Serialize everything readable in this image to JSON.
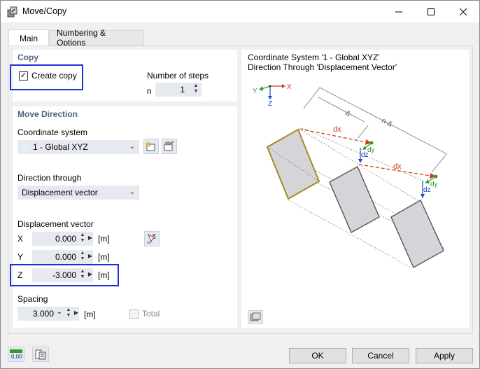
{
  "window": {
    "title": "Move/Copy",
    "icon": "move-copy-app-icon",
    "controls": [
      "minimize-icon",
      "maximize-icon",
      "close-icon"
    ]
  },
  "tabs": [
    {
      "label": "Main",
      "active": true
    },
    {
      "label": "Numbering & Options",
      "active": false
    }
  ],
  "copy_group": {
    "title": "Copy",
    "create_copy_label": "Create copy",
    "create_copy_checked": true,
    "number_of_steps_label": "Number of steps",
    "n_label": "n",
    "n_value": "1"
  },
  "move_direction": {
    "title": "Move Direction",
    "coordinate_system_label": "Coordinate system",
    "coordinate_system_value": "1 - Global XYZ",
    "direction_through_label": "Direction through",
    "direction_through_value": "Displacement vector",
    "displacement_vector_label": "Displacement vector",
    "x_label": "X",
    "x_value": "0.000",
    "x_unit": "[m]",
    "y_label": "Y",
    "y_value": "0.000",
    "y_unit": "[m]",
    "z_label": "Z",
    "z_value": "-3.000",
    "z_unit": "[m]",
    "spacing_label": "Spacing",
    "spacing_value": "3.000",
    "spacing_unit": "[m]",
    "total_label": "Total",
    "total_checked": false
  },
  "preview": {
    "line1": "Coordinate System '1 - Global XYZ'",
    "line2": "Direction Through 'Displacement Vector'",
    "axis_x": "X",
    "axis_y": "Y",
    "axis_z": "Z",
    "delta": "Δ",
    "n_delta": "n·Δ",
    "dx": "dx",
    "dy": "dy",
    "dz": "dz",
    "dx2": "dx",
    "dy2": "dy",
    "dz2": "dz"
  },
  "buttons": {
    "ok": "OK",
    "cancel": "Cancel",
    "apply": "Apply",
    "units_icon_text": "0,00"
  },
  "colors": {
    "highlight": "#1f2fd6",
    "field_bg": "#e6eaf0",
    "group_title": "#4d6482",
    "dimension_red": "#d43a1a",
    "dimension_green": "#2e9b2e",
    "dimension_blue": "#1b46c8"
  }
}
